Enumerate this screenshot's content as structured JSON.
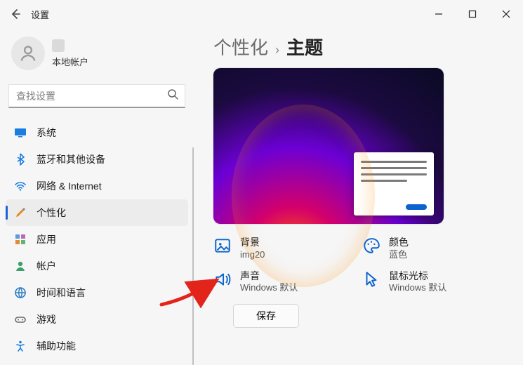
{
  "window": {
    "title": "设置",
    "account_label": "本地帐户"
  },
  "search": {
    "placeholder": "查找设置"
  },
  "nav": [
    {
      "id": "system",
      "label": "系统"
    },
    {
      "id": "bluetooth",
      "label": "蓝牙和其他设备"
    },
    {
      "id": "network",
      "label": "网络 & Internet"
    },
    {
      "id": "personalization",
      "label": "个性化"
    },
    {
      "id": "apps",
      "label": "应用"
    },
    {
      "id": "accounts",
      "label": "帐户"
    },
    {
      "id": "time",
      "label": "时间和语言"
    },
    {
      "id": "gaming",
      "label": "游戏"
    },
    {
      "id": "accessibility",
      "label": "辅助功能"
    }
  ],
  "breadcrumb": {
    "parent": "个性化",
    "current": "主题"
  },
  "options": {
    "background": {
      "title": "背景",
      "value": "img20"
    },
    "color": {
      "title": "颜色",
      "value": "蓝色"
    },
    "sound": {
      "title": "声音",
      "value": "Windows 默认"
    },
    "cursor": {
      "title": "鼠标光标",
      "value": "Windows 默认"
    }
  },
  "buttons": {
    "save": "保存"
  },
  "colors": {
    "accent": "#0b63ce",
    "arrow": "#e3241b"
  }
}
